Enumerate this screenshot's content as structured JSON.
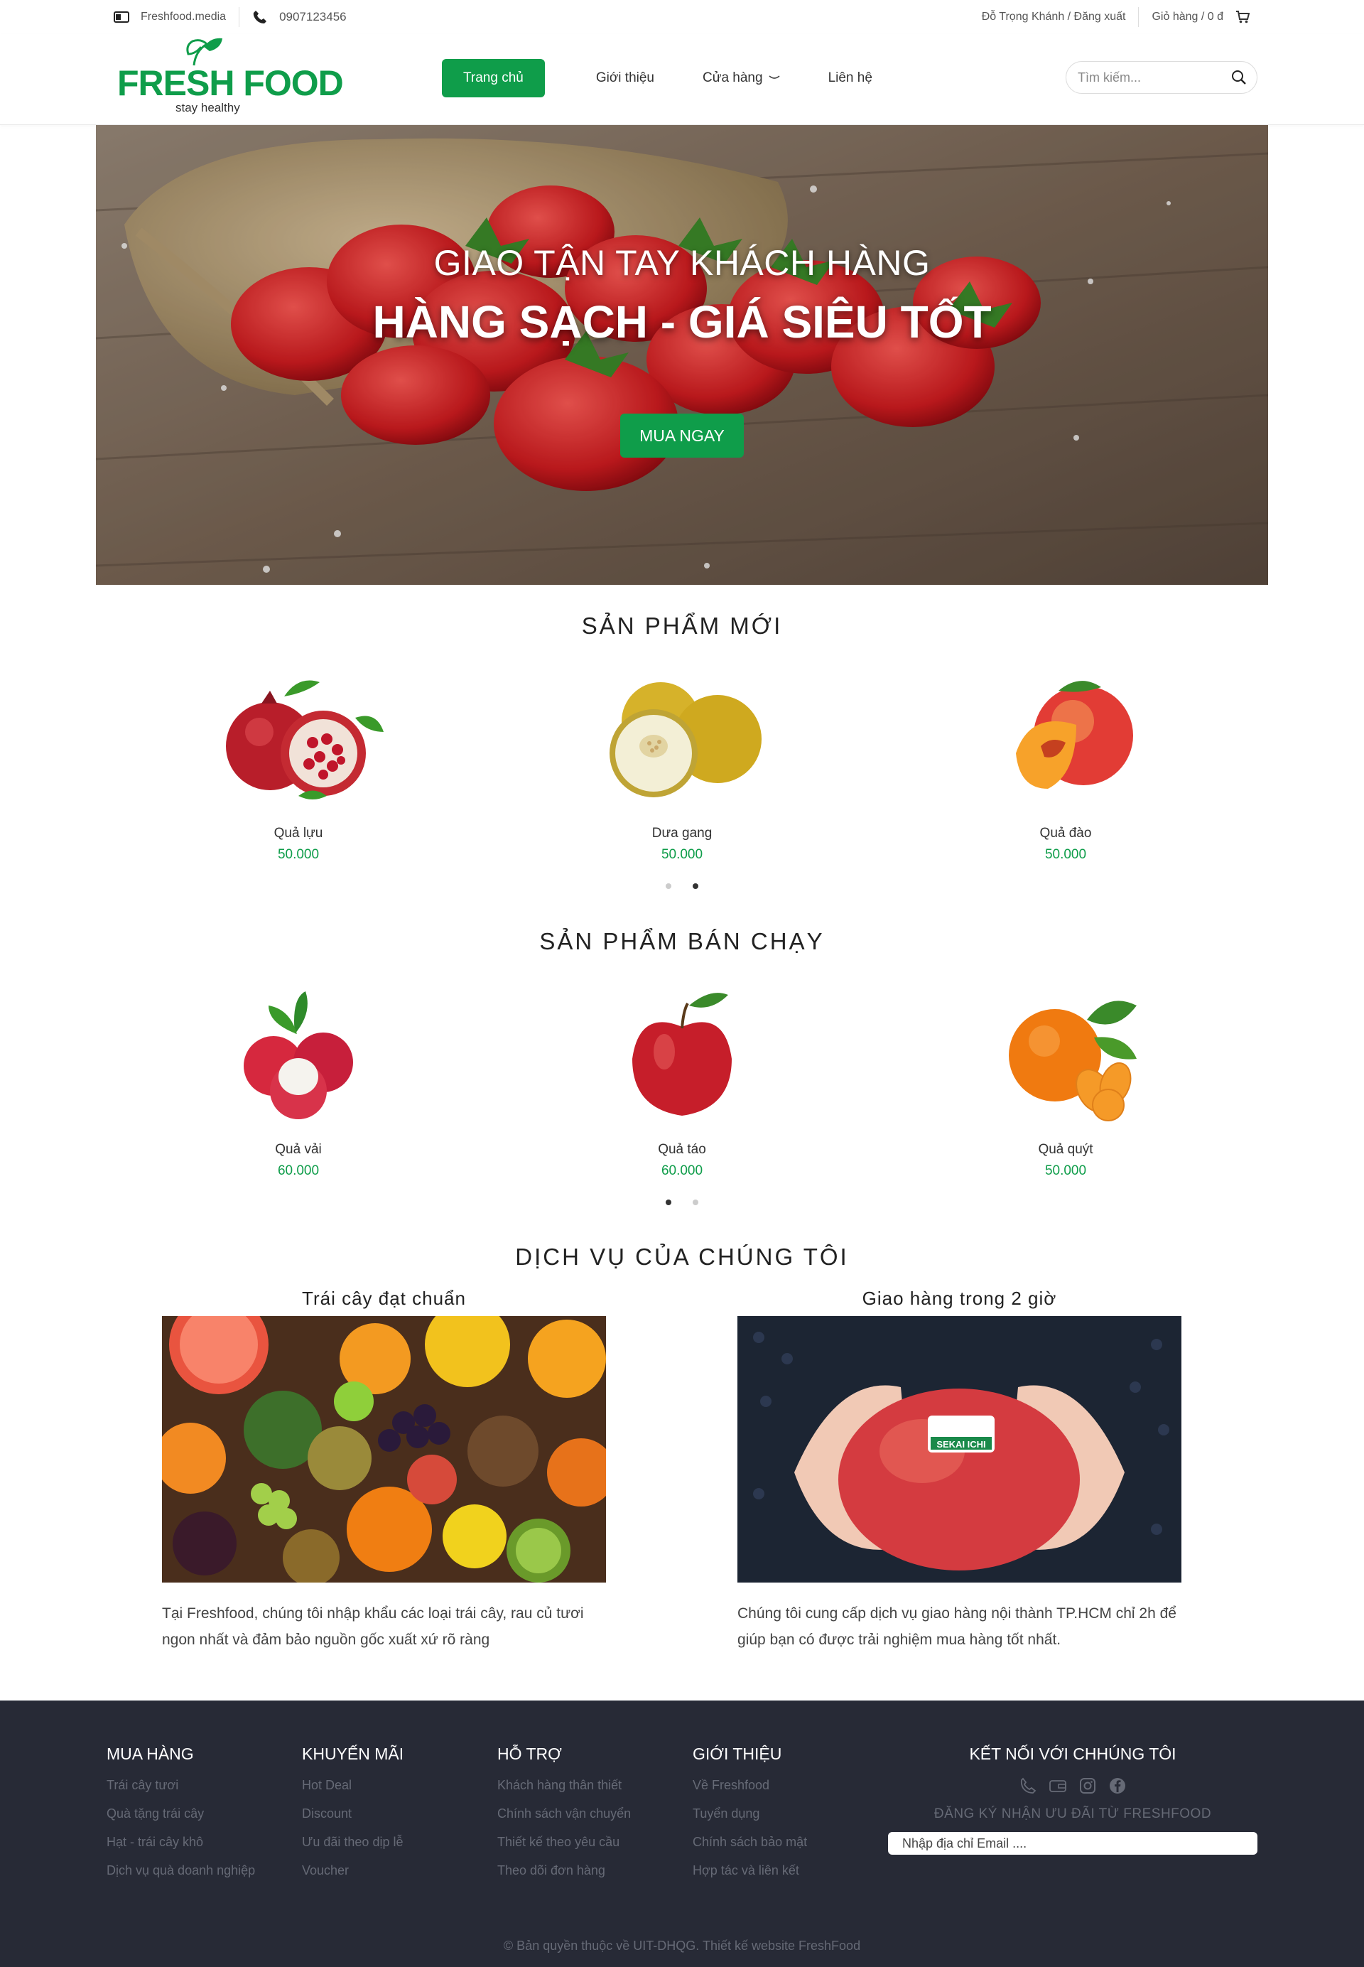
{
  "topbar": {
    "media": "Freshfood.media",
    "phone": "0907123456",
    "account": "Đỗ Trọng Khánh / Đăng xuất",
    "cart": "Giỏ hàng / 0 đ"
  },
  "logo": {
    "brand": "FRESH FOOD",
    "tagline": "stay healthy"
  },
  "nav": {
    "home": "Trang chủ",
    "about": "Giới thiệu",
    "store": "Cửa hàng",
    "contact": "Liên hệ"
  },
  "search": {
    "placeholder": "Tìm kiếm..."
  },
  "hero": {
    "subtitle": "GIAO TẬN TAY KHÁCH HÀNG",
    "title": "HÀNG SẠCH - GIÁ SIÊU TỐT",
    "cta": "MUA NGAY"
  },
  "new_products": {
    "title": "SẢN PHẨM MỚI",
    "items": [
      {
        "name": "Quả lựu",
        "price": "50.000"
      },
      {
        "name": "Dưa gang",
        "price": "50.000"
      },
      {
        "name": "Quả đào",
        "price": "50.000"
      }
    ]
  },
  "best_sellers": {
    "title": "SẢN PHẨM BÁN CHẠY",
    "items": [
      {
        "name": "Quả vải",
        "price": "60.000"
      },
      {
        "name": "Quả táo",
        "price": "60.000"
      },
      {
        "name": "Quả quýt",
        "price": "50.000"
      }
    ]
  },
  "services": {
    "title": "DỊCH VỤ CỦA CHÚNG TÔI",
    "items": [
      {
        "title": "Trái cây đạt chuẩn",
        "desc": "Tại Freshfood, chúng tôi nhập khẩu các loại trái cây, rau củ tươi ngon nhất và đảm bảo nguồn gốc xuất xứ rõ ràng"
      },
      {
        "title": "Giao hàng trong 2 giờ",
        "desc": "Chúng tôi cung cấp dịch vụ giao hàng nội thành TP.HCM chỉ 2h để giúp bạn có được trải nghiệm mua hàng tốt nhất."
      }
    ],
    "sticker": "SEKAI ICHI"
  },
  "footer": {
    "columns": [
      {
        "title": "MUA HÀNG",
        "links": [
          "Trái cây tươi",
          "Quà tặng trái cây",
          "Hạt - trái cây khô",
          "Dịch vụ quà doanh nghiệp"
        ]
      },
      {
        "title": "KHUYẾN MÃI",
        "links": [
          "Hot Deal",
          "Discount",
          "Ưu đãi theo dịp lễ",
          "Voucher"
        ]
      },
      {
        "title": "HỖ TRỢ",
        "links": [
          "Khách hàng thân thiết",
          "Chính sách vận chuyển",
          "Thiết kế theo yêu cầu",
          "Theo dõi đơn hàng"
        ]
      },
      {
        "title": "GIỚI THIỆU",
        "links": [
          "Về Freshfood",
          "Tuyển dụng",
          "Chính sách bảo mật",
          "Hợp tác và liên kết"
        ]
      }
    ],
    "connect_title": "KẾT NỐI VỚI CHHÚNG TÔI",
    "newsletter": "ĐĂNG KÝ NHẬN ƯU ĐÃI TỪ FRESHFOOD",
    "email_placeholder": "Nhập địa chỉ Email ....",
    "copyright": "© Bản quyền thuộc về UIT-DHQG. Thiết kế website FreshFood"
  },
  "icons": {
    "media": "media-card-icon",
    "phone": "phone-icon",
    "cart": "cart-icon",
    "search": "search-icon",
    "chevron": "chevron-down-icon",
    "facebook": "facebook-icon",
    "instagram": "instagram-icon",
    "wallet": "wallet-icon"
  },
  "colors": {
    "accent": "#0f9d4a",
    "footer_bg": "#272a36",
    "footer_text": "#666a76"
  }
}
